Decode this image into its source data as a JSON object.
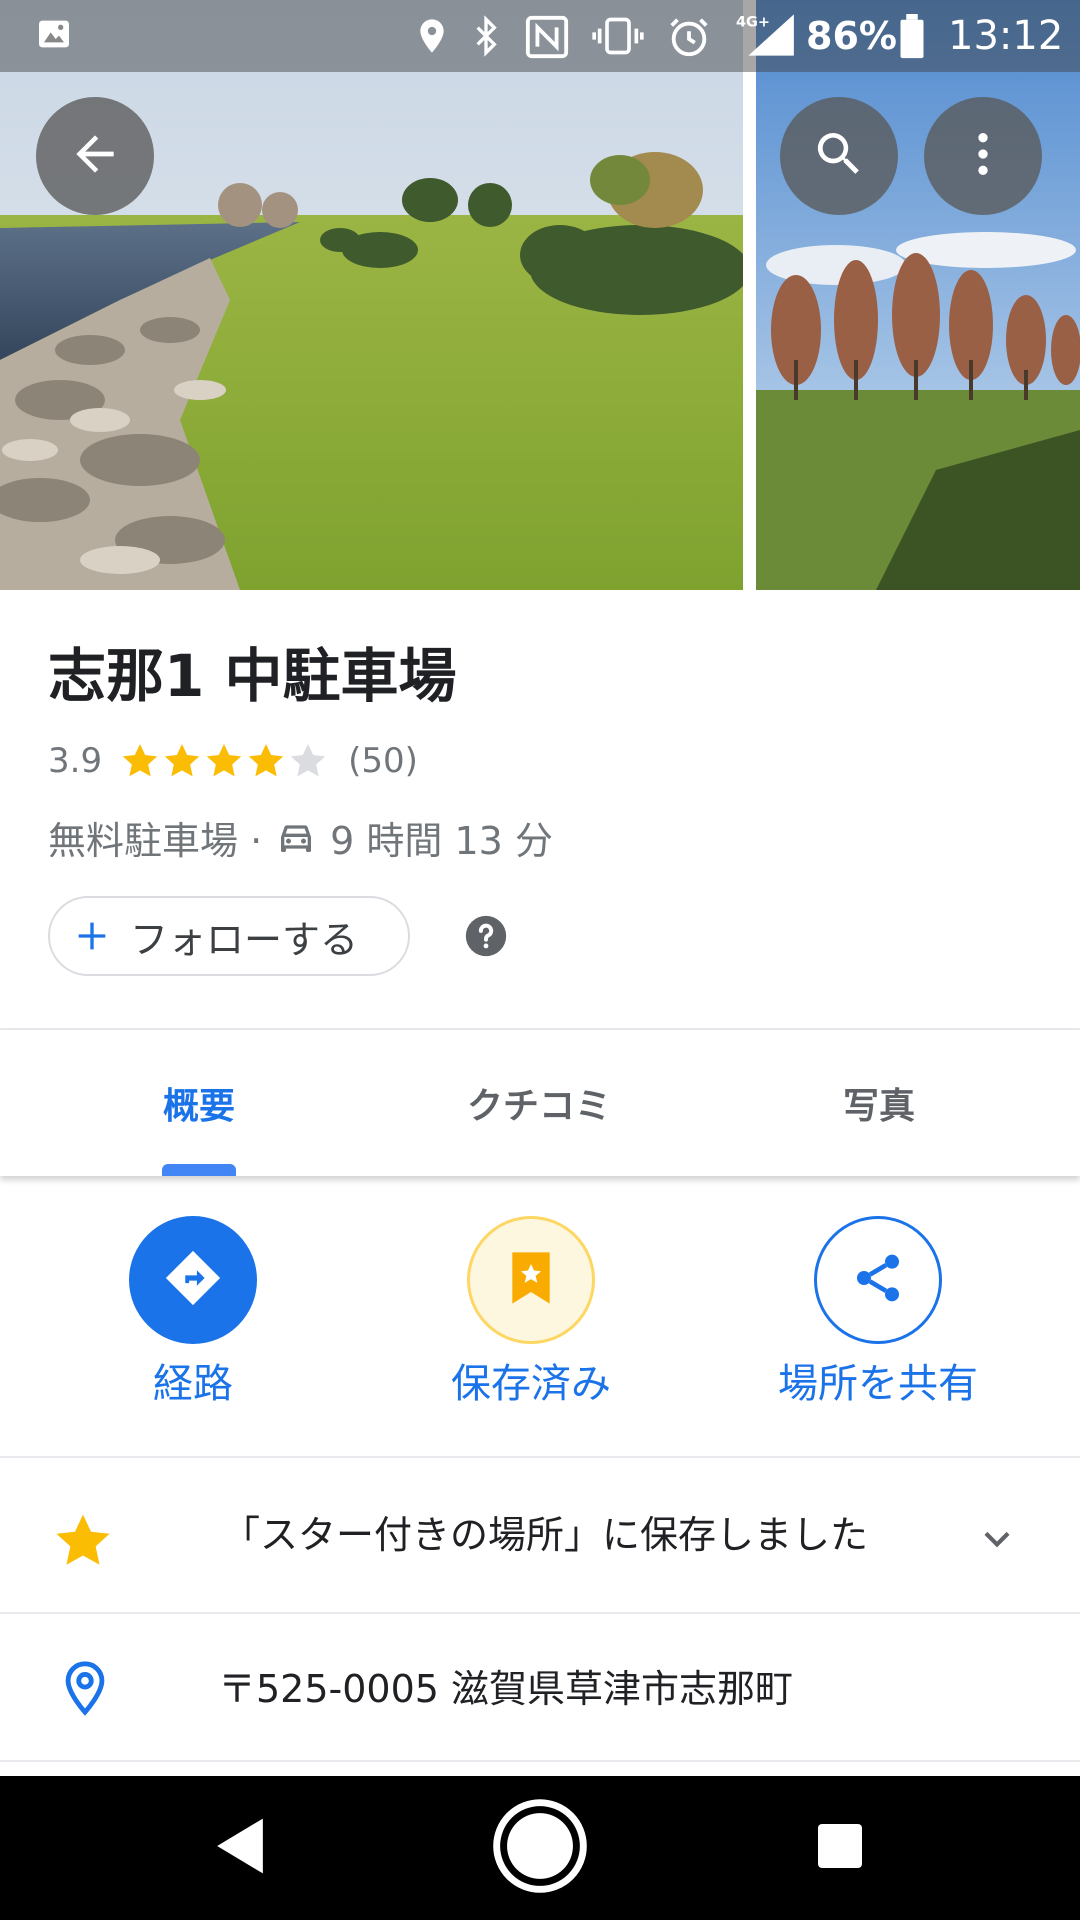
{
  "status_bar": {
    "battery_percent": "86%",
    "time": "13:12",
    "network": "4G+",
    "icons": [
      "image-icon",
      "location-icon",
      "bluetooth-icon",
      "nfc-icon",
      "vibrate-icon",
      "alarm-icon",
      "signal-icon",
      "battery-icon"
    ]
  },
  "header": {
    "back_icon": "arrow-back-icon",
    "search_icon": "search-icon",
    "more_icon": "more-vert-icon"
  },
  "place": {
    "name": "志那1 中駐車場",
    "rating": "3.9",
    "rating_value": 3.9,
    "rating_max": 5,
    "review_count": "(50)",
    "category": "無料駐車場 ·",
    "drive_time": "9 時間 13 分",
    "follow_label": "フォローする"
  },
  "tabs": [
    {
      "label": "概要",
      "active": true
    },
    {
      "label": "クチコミ",
      "active": false
    },
    {
      "label": "写真",
      "active": false
    }
  ],
  "actions": {
    "directions_label": "経路",
    "saved_label": "保存済み",
    "share_label": "場所を共有"
  },
  "rows": {
    "saved_text": "「スター付きの場所」に保存しました",
    "address_text": "〒525-0005 滋賀県草津市志那町"
  },
  "colors": {
    "accent": "#1a73e8",
    "star": "#fbbc04",
    "saved_bg": "#fef7e0",
    "saved_border": "#fdd663"
  }
}
